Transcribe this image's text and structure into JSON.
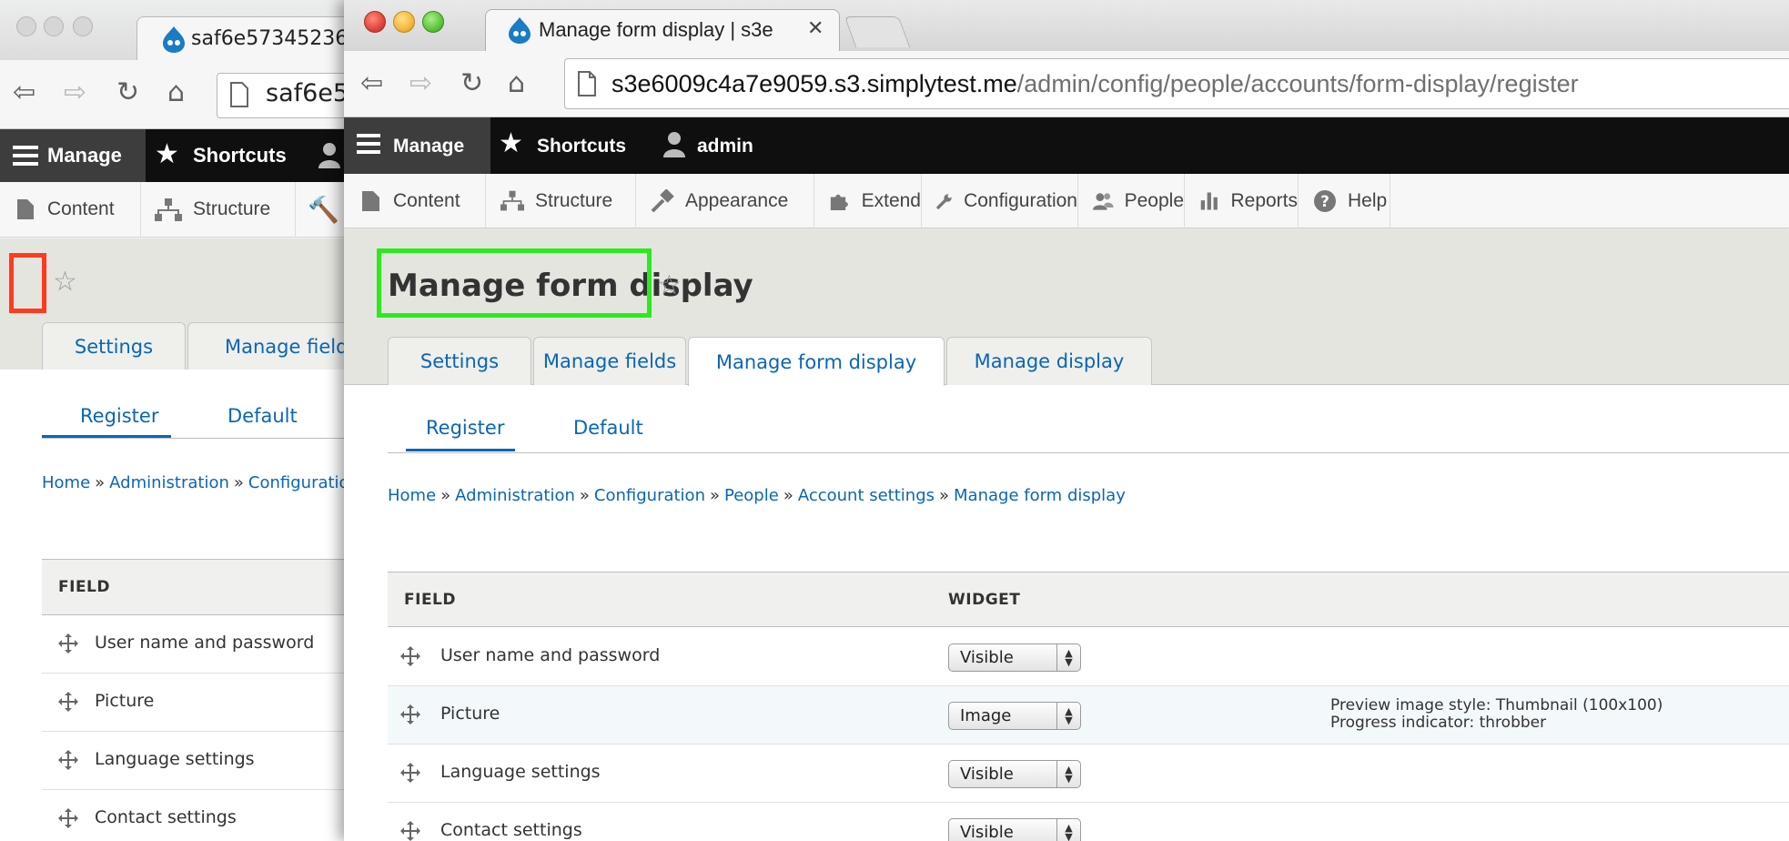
{
  "back_window": {
    "tab_title": "saf6e57345236",
    "url_text": "saf6e5",
    "toolbar": {
      "manage": "Manage",
      "shortcuts": "Shortcuts"
    },
    "tray": {
      "content": "Content",
      "structure": "Structure"
    },
    "tabs": [
      "Settings",
      "Manage fields"
    ],
    "subtabs": [
      "Register",
      "Default"
    ],
    "breadcrumb": [
      "Home",
      "Administration",
      "Configuratio"
    ],
    "table": {
      "header": "FIELD",
      "rows": [
        "User name and password",
        "Picture",
        "Language settings",
        "Contact settings"
      ]
    }
  },
  "front_window": {
    "tab_title": "Manage form display | s3e",
    "tab_close": "✕",
    "url": {
      "host": "s3e6009c4a7e9059.s3.simplytest.me",
      "path": "/admin/config/people/accounts/form-display/register"
    },
    "toolbar": {
      "manage": "Manage",
      "shortcuts": "Shortcuts",
      "user": "admin"
    },
    "tray": [
      {
        "label": "Content",
        "icon": "page-icon"
      },
      {
        "label": "Structure",
        "icon": "structure-icon"
      },
      {
        "label": "Appearance",
        "icon": "paintbrush-icon"
      },
      {
        "label": "Extend",
        "icon": "puzzle-icon"
      },
      {
        "label": "Configuration",
        "icon": "wrench-icon"
      },
      {
        "label": "People",
        "icon": "people-icon"
      },
      {
        "label": "Reports",
        "icon": "bar-chart-icon"
      },
      {
        "label": "Help",
        "icon": "help-icon"
      }
    ],
    "page_title": "Manage form display",
    "primary_tabs": [
      "Settings",
      "Manage fields",
      "Manage form display",
      "Manage display"
    ],
    "active_tab": "Manage form display",
    "subtabs": [
      "Register",
      "Default"
    ],
    "active_subtab": "Register",
    "breadcrumb": [
      "Home",
      "Administration",
      "Configuration",
      "People",
      "Account settings",
      "Manage form display"
    ],
    "breadcrumb_separator": "»",
    "table": {
      "headers": {
        "field": "FIELD",
        "widget": "WIDGET"
      },
      "rows": [
        {
          "field": "User name and password",
          "widget": "Visible",
          "summary": [
            "",
            ""
          ]
        },
        {
          "field": "Picture",
          "widget": "Image",
          "summary": [
            "Preview image style: Thumbnail (100x100)",
            "Progress indicator: throbber"
          ]
        },
        {
          "field": "Language settings",
          "widget": "Visible",
          "summary": [
            "",
            ""
          ]
        },
        {
          "field": "Contact settings",
          "widget": "Visible",
          "summary": [
            "",
            ""
          ]
        }
      ]
    }
  },
  "colors": {
    "link": "#0a66b5",
    "toolbar_bg": "#0f0f0f",
    "manage_bg": "#3d3d3d",
    "header_area_bg": "#e5e5e0",
    "highlight_red": "#ff3b1f",
    "highlight_green": "#2bea1f"
  }
}
